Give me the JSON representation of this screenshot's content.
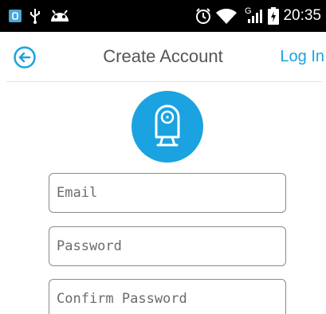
{
  "status_bar": {
    "time": "20:35",
    "network_type": "G",
    "icons": [
      "app-notification-icon",
      "usb-icon",
      "android-debug-icon",
      "alarm-icon",
      "wifi-icon",
      "signal-icon",
      "battery-charging-icon"
    ]
  },
  "header": {
    "title": "Create Account",
    "login_label": "Log In",
    "back_icon": "arrow-left-circle-icon"
  },
  "logo": {
    "icon": "camera-logo-icon",
    "color": "#1aa3e0"
  },
  "form": {
    "email_placeholder": "Email",
    "password_placeholder": "Password",
    "confirm_password_placeholder": "Confirm Password"
  },
  "colors": {
    "accent": "#1aa3e0",
    "title_text": "#555555",
    "status_bar_bg": "#000000"
  }
}
